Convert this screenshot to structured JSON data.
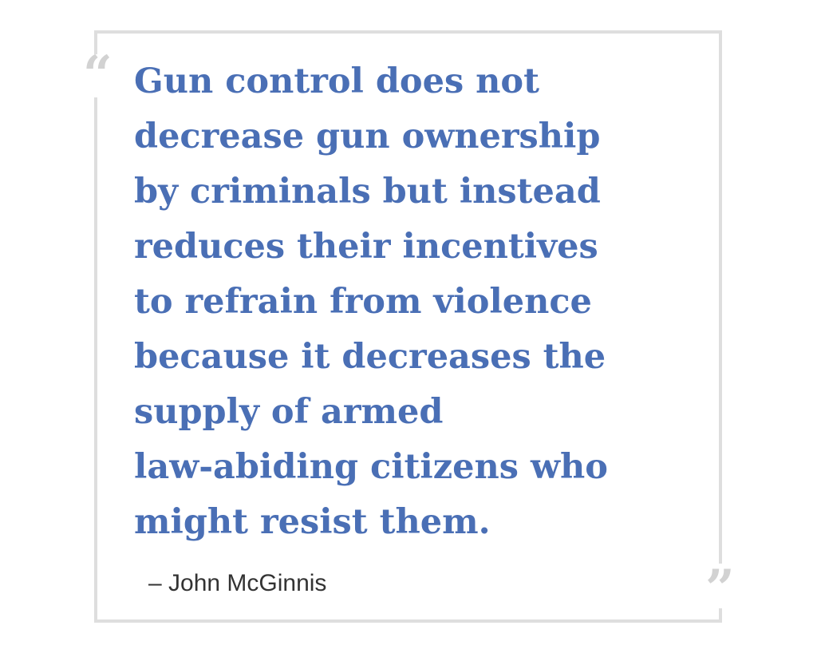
{
  "quote": {
    "open_mark": "“",
    "close_mark": "”",
    "lines": [
      "Gun control does not",
      "decrease gun ownership",
      "by criminals but instead",
      "reduces their incentives",
      "to refrain from violence",
      "because it decreases the",
      "supply of armed",
      "law-abiding citizens who",
      "might resist them."
    ],
    "attribution": "– John McGinnis"
  },
  "colors": {
    "quote_text": "#4a6fb5",
    "frame": "#dedede",
    "quote_marks": "#d2d2d2",
    "attribution": "#333333"
  }
}
